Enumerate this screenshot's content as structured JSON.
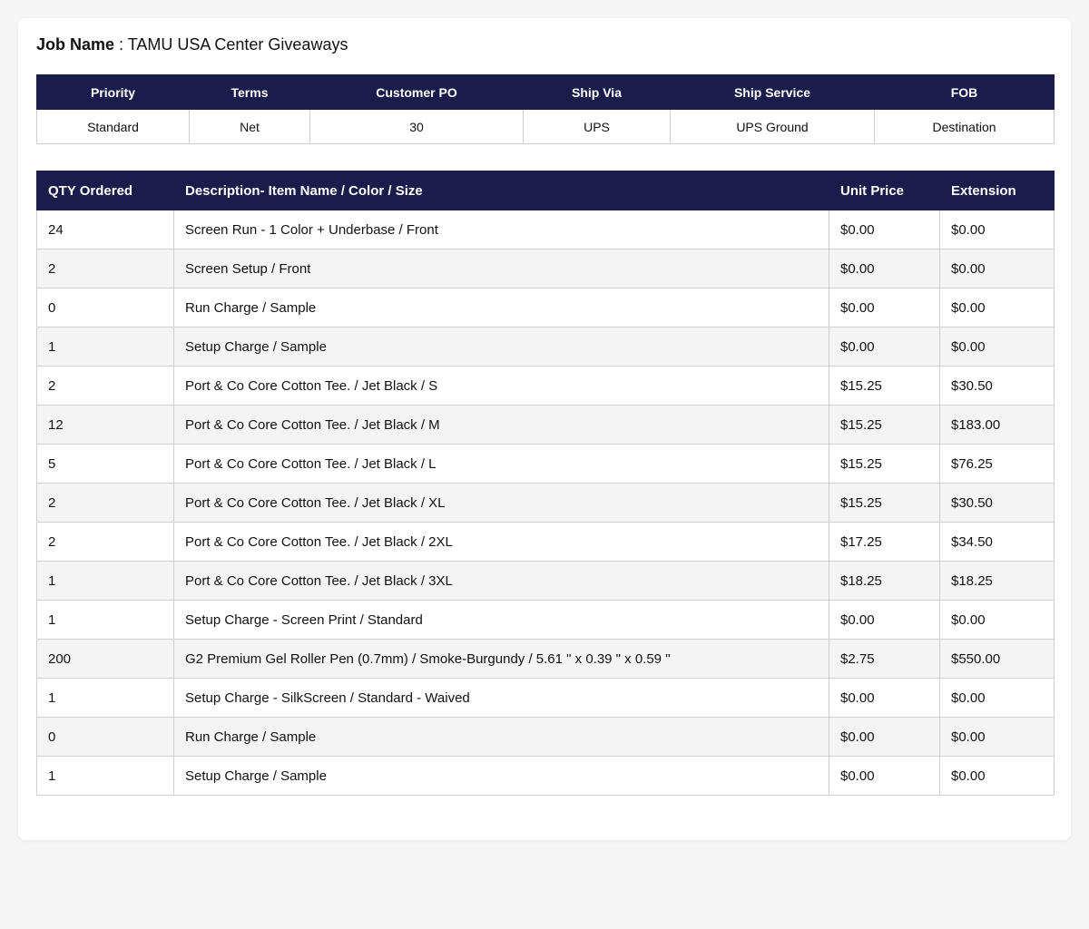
{
  "job": {
    "label": "Job Name",
    "separator": " : ",
    "value": "TAMU USA Center Giveaways"
  },
  "order_meta": {
    "headers": [
      "Priority",
      "Terms",
      "Customer PO",
      "Ship Via",
      "Ship Service",
      "FOB"
    ],
    "values": [
      "Standard",
      "Net",
      "30",
      "UPS",
      "UPS Ground",
      "Destination"
    ]
  },
  "line_items": {
    "headers": [
      "QTY Ordered",
      "Description- Item Name / Color / Size",
      "Unit Price",
      "Extension"
    ],
    "rows": [
      {
        "qty": "24",
        "description": "Screen Run - 1 Color + Underbase / Front",
        "unit_price": "$0.00",
        "extension": "$0.00"
      },
      {
        "qty": "2",
        "description": "Screen Setup / Front",
        "unit_price": "$0.00",
        "extension": "$0.00"
      },
      {
        "qty": "0",
        "description": "Run Charge / Sample",
        "unit_price": "$0.00",
        "extension": "$0.00"
      },
      {
        "qty": "1",
        "description": "Setup Charge / Sample",
        "unit_price": "$0.00",
        "extension": "$0.00"
      },
      {
        "qty": "2",
        "description": "Port & Co Core Cotton Tee. / Jet Black / S",
        "unit_price": "$15.25",
        "extension": "$30.50"
      },
      {
        "qty": "12",
        "description": "Port & Co Core Cotton Tee. / Jet Black / M",
        "unit_price": "$15.25",
        "extension": "$183.00"
      },
      {
        "qty": "5",
        "description": "Port & Co Core Cotton Tee. / Jet Black / L",
        "unit_price": "$15.25",
        "extension": "$76.25"
      },
      {
        "qty": "2",
        "description": "Port & Co Core Cotton Tee. / Jet Black / XL",
        "unit_price": "$15.25",
        "extension": "$30.50"
      },
      {
        "qty": "2",
        "description": "Port & Co Core Cotton Tee. / Jet Black / 2XL",
        "unit_price": "$17.25",
        "extension": "$34.50"
      },
      {
        "qty": "1",
        "description": "Port & Co Core Cotton Tee. / Jet Black / 3XL",
        "unit_price": "$18.25",
        "extension": "$18.25"
      },
      {
        "qty": "1",
        "description": "Setup Charge - Screen Print / Standard",
        "unit_price": "$0.00",
        "extension": "$0.00"
      },
      {
        "qty": "200",
        "description": "G2 Premium Gel Roller Pen (0.7mm) / Smoke-Burgundy / 5.61 \" x 0.39 \" x 0.59 \"",
        "unit_price": "$2.75",
        "extension": "$550.00"
      },
      {
        "qty": "1",
        "description": "Setup Charge - SilkScreen / Standard - Waived",
        "unit_price": "$0.00",
        "extension": "$0.00"
      },
      {
        "qty": "0",
        "description": "Run Charge / Sample",
        "unit_price": "$0.00",
        "extension": "$0.00"
      },
      {
        "qty": "1",
        "description": "Setup Charge / Sample",
        "unit_price": "$0.00",
        "extension": "$0.00"
      }
    ]
  },
  "colors": {
    "header_bg": "#1c1c4c",
    "header_text": "#ffffff",
    "stripe": "#f4f4f4",
    "page_bg": "#f5f5f5"
  }
}
